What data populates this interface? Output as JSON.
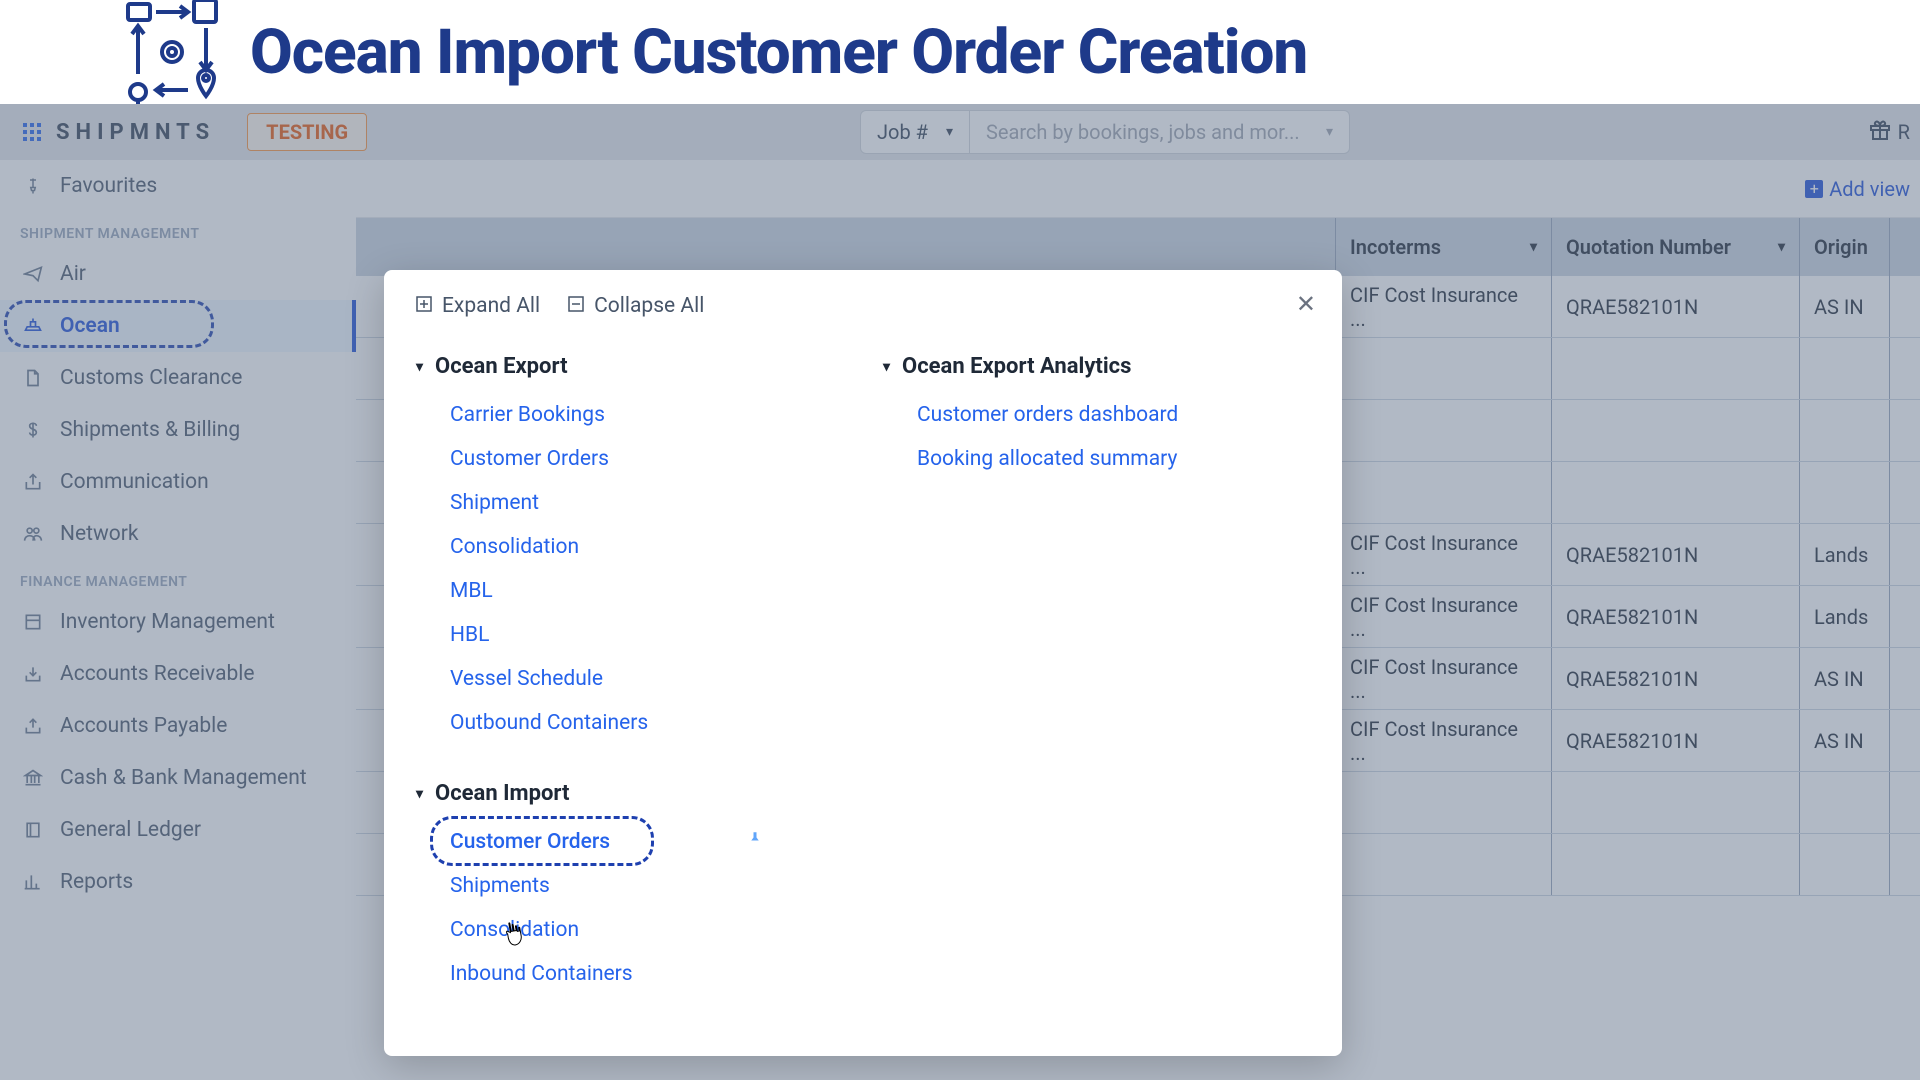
{
  "banner": {
    "title": "Ocean Import Customer Order Creation"
  },
  "toolbar": {
    "brand": "SHIPMNTS",
    "testing_badge": "TESTING",
    "job_select": "Job #",
    "search_placeholder": "Search by bookings, jobs and mor...",
    "rewards_label": "R"
  },
  "sidebar": {
    "favourites": "Favourites",
    "section_shipment": "SHIPMENT MANAGEMENT",
    "section_finance": "FINANCE MANAGEMENT",
    "items": {
      "air": "Air",
      "ocean": "Ocean",
      "customs": "Customs Clearance",
      "shipbill": "Shipments & Billing",
      "comm": "Communication",
      "network": "Network",
      "inventory": "Inventory Management",
      "ar": "Accounts Receivable",
      "ap": "Accounts Payable",
      "cashbank": "Cash & Bank Management",
      "ledger": "General Ledger",
      "reports": "Reports"
    }
  },
  "addview": "Add view",
  "table": {
    "headers": {
      "incoterms": "Incoterms",
      "quote": "Quotation Number",
      "origin": "Origin"
    },
    "rows": [
      {
        "incoterms": "CIF Cost Insurance ...",
        "quote": "QRAE582101N",
        "origin": "AS IN"
      },
      {
        "incoterms": "",
        "quote": "",
        "origin": ""
      },
      {
        "incoterms": "",
        "quote": "",
        "origin": ""
      },
      {
        "incoterms": "",
        "quote": "",
        "origin": ""
      },
      {
        "incoterms": "CIF Cost Insurance ...",
        "quote": "QRAE582101N",
        "origin": "Lands"
      },
      {
        "incoterms": "CIF Cost Insurance ...",
        "quote": "QRAE582101N",
        "origin": "Lands"
      },
      {
        "incoterms": "CIF Cost Insurance ...",
        "quote": "QRAE582101N",
        "origin": "AS IN"
      },
      {
        "incoterms": "CIF Cost Insurance ...",
        "quote": "QRAE582101N",
        "origin": "AS IN"
      },
      {
        "incoterms": "",
        "quote": "",
        "origin": ""
      },
      {
        "incoterms": "",
        "quote": "",
        "origin": ""
      }
    ]
  },
  "popover": {
    "expand_all": "Expand All",
    "collapse_all": "Collapse All",
    "groups": {
      "ocean_export": {
        "title": "Ocean Export",
        "items": [
          "Carrier Bookings",
          "Customer Orders",
          "Shipment",
          "Consolidation",
          "MBL",
          "HBL",
          "Vessel Schedule",
          "Outbound Containers"
        ]
      },
      "ocean_import": {
        "title": "Ocean Import",
        "items": [
          "Customer Orders",
          "Shipments",
          "Consolidation",
          "Inbound Containers"
        ]
      },
      "ocean_export_analytics": {
        "title": "Ocean Export Analytics",
        "items": [
          "Customer orders dashboard",
          "Booking allocated summary"
        ]
      }
    }
  }
}
